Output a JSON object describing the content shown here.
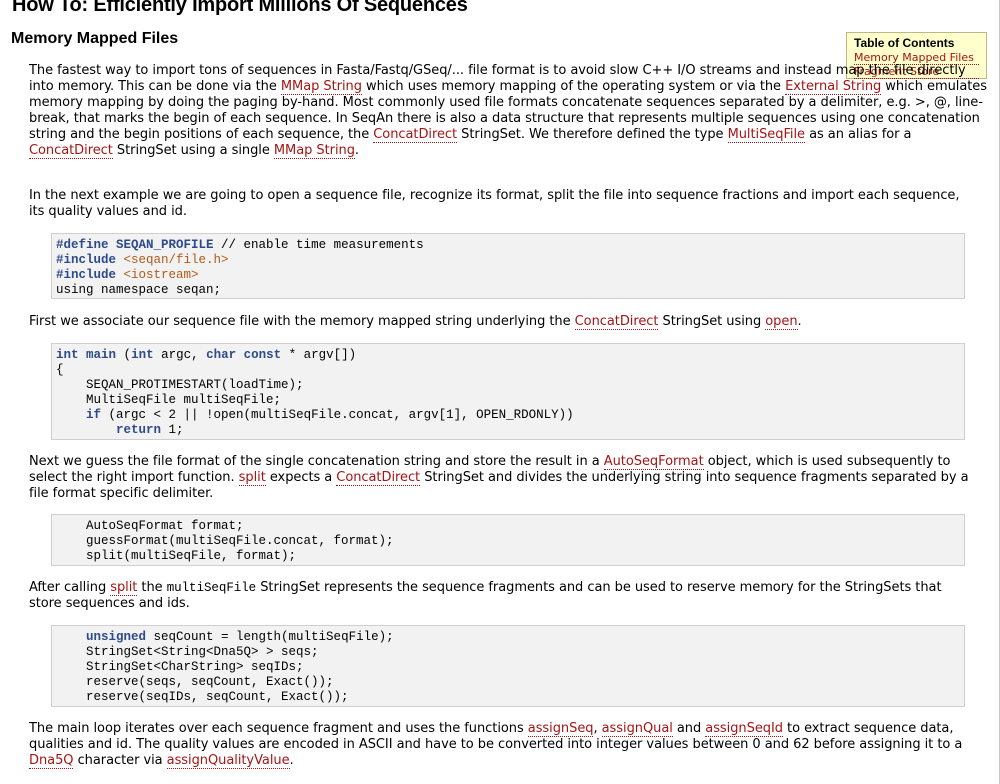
{
  "page": {
    "title": "How To: Efficiently Import Millions Of Sequences"
  },
  "section": {
    "title": "Memory Mapped Files"
  },
  "toc": {
    "title": "Table of Contents",
    "items": [
      "Memory Mapped Files",
      "Fragment Store"
    ]
  },
  "p1": {
    "t1": "The fastest way to import tons of sequences in Fasta/Fastq/GSeq/... file format is to avoid slow C++ I/O streams and instead map the file directly into memory. This can be done via the ",
    "l1": "MMap String",
    "t2": " which uses memory mapping of the operating system or via the ",
    "l2": "External String",
    "t3": " which emulates memory mapping by doing the paging by-hand. Most commonly used file formats concatenate sequences separated by a delimiter, e.g. >, @, line-break, that marks the begin of each sequence. In SeqAn there is also a data structure that represents multiple sequences using one concatenation string and the begin positions of each sequence, the ",
    "l3": "ConcatDirect",
    "t4": " StringSet. We therefore defined the type ",
    "l4": "MultiSeqFile",
    "t5": " as an alias for a ",
    "l5": "ConcatDirect",
    "t6": " StringSet using a single ",
    "l6": "MMap String",
    "t7": "."
  },
  "p2": {
    "text": "In the next example we are going to open a sequence file, recognize its format, split the file into sequence fractions and import each sequence, its quality values and id."
  },
  "code1": {
    "l1_kw": "#define",
    "l1_name": " SEQAN_PROFILE",
    "l1_rest": " // enable time measurements",
    "l2_kw": "#include",
    "l2_str": " <seqan/file.h>",
    "l3_kw": "#include",
    "l3_str": " <iostream>",
    "l4": "using namespace seqan;"
  },
  "p3": {
    "t1": "First we associate our sequence file with the memory mapped string underlying the ",
    "l1": "ConcatDirect",
    "t2": " StringSet using ",
    "l2": "open",
    "t3": "."
  },
  "code2": {
    "a1": "int",
    "a2": " ",
    "a3": "main",
    "a4": " (",
    "a5": "int",
    "a6": " argc, ",
    "a7": "char const",
    "a8": " * argv[])",
    "b": "{",
    "c": "    SEQAN_PROTIMESTART(loadTime);",
    "d": "    MultiSeqFile multiSeqFile;",
    "e_kw": "if",
    "e_rest": " (argc < 2 || !open(multiSeqFile.concat, argv[1], OPEN_RDONLY))",
    "f_kw": "return",
    "f_rest": " 1;"
  },
  "p4": {
    "t1": "Next we guess the file format of the single concatenation string and store the result in a ",
    "l1": "AutoSeqFormat",
    "t2": " object, which is used subsequently to select the right import function. ",
    "l2": "split",
    "t3": " expects a ",
    "l3": "ConcatDirect",
    "t4": " StringSet and divides the underlying string into sequence fragments separated by a file format specific delimiter."
  },
  "code3": {
    "l1": "    AutoSeqFormat format;",
    "l2": "    guessFormat(multiSeqFile.concat, format);",
    "l3": "    split(multiSeqFile, format);"
  },
  "p5": {
    "t1": "After calling ",
    "l1": "split",
    "t2": " the ",
    "m1": "multiSeqFile",
    "t3": " StringSet represents the sequence fragments and can be used to reserve memory for the StringSets that store sequences and ids."
  },
  "code4": {
    "l1_kw": "unsigned",
    "l1_rest": " seqCount = length(multiSeqFile);",
    "l2": "    StringSet<String<Dna5Q> > seqs;",
    "l3": "    StringSet<CharString> seqIDs;",
    "l4": "    reserve(seqs, seqCount, Exact());",
    "l5": "    reserve(seqIDs, seqCount, Exact());"
  },
  "p6": {
    "t1": "The main loop iterates over each sequence fragment and uses the functions ",
    "l1": "assignSeq",
    "t2": ", ",
    "l2": "assignQual",
    "t3": " and ",
    "l3": "assignSeqId",
    "t4": " to extract sequence data, qualities and id. The quality values are encoded in ASCII and have to be converted into integer values between 0 and 62 before assigning it to a ",
    "l4": "Dna5Q",
    "t5": " character via ",
    "l5": "assignQualityValue",
    "t6": "."
  },
  "colors": {
    "link": "#a31515",
    "keyword": "#2c4a8c",
    "include_string": "#b05a1a",
    "code_bg": "#f2f2f2",
    "toc_bg": "#ffffcc"
  }
}
